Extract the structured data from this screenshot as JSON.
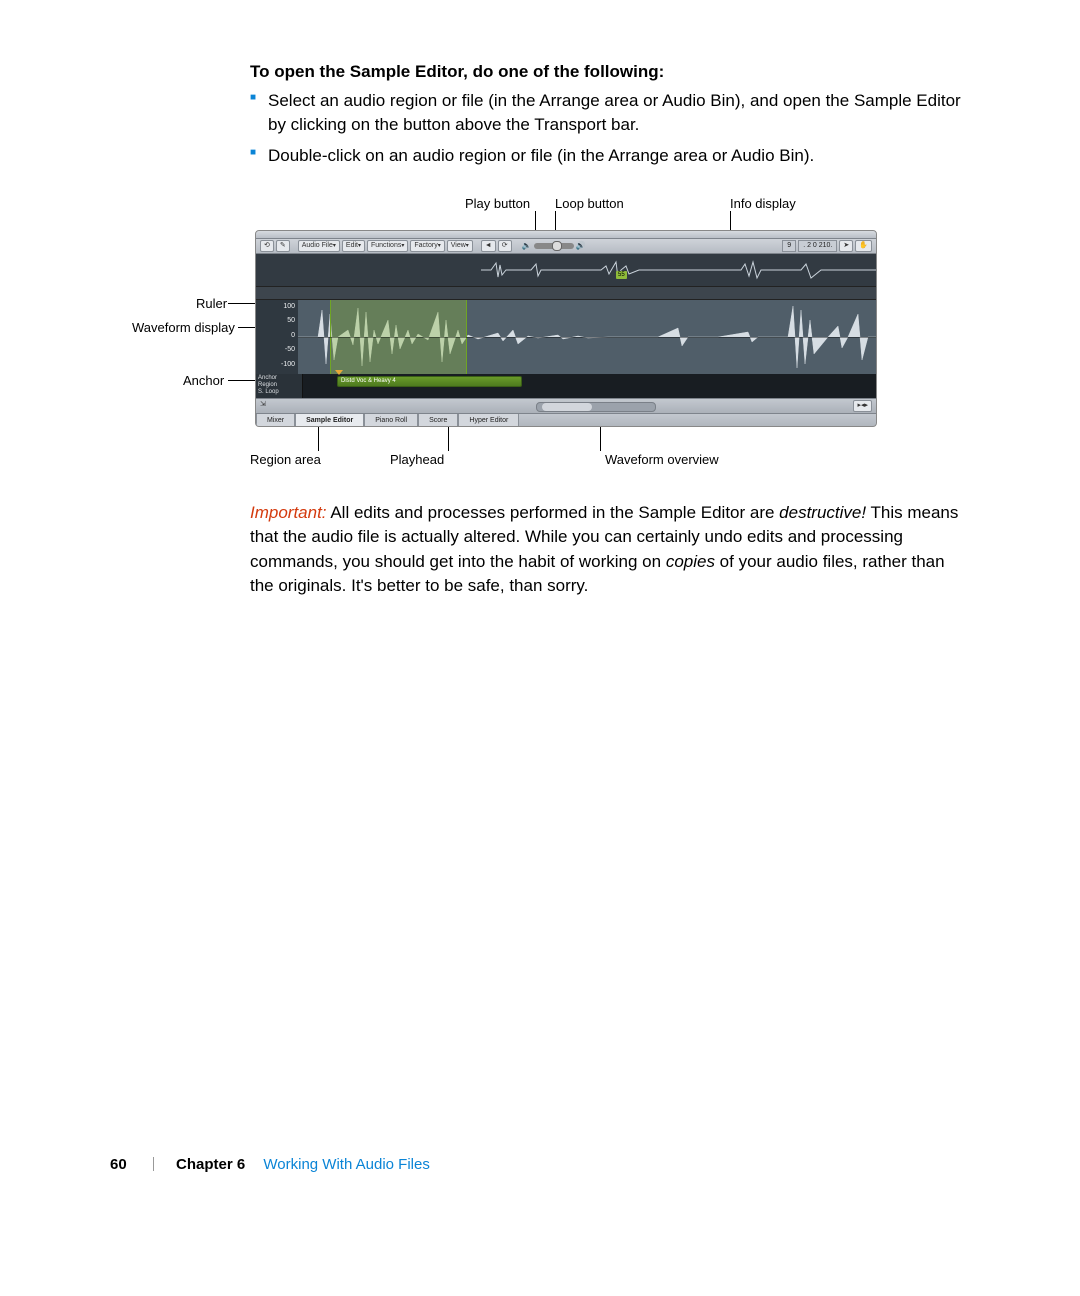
{
  "heading": "To open the Sample Editor, do one of the following:",
  "bullets": [
    "Select an audio region or file (in the Arrange area or Audio Bin), and open the Sample Editor by clicking on the button above the Transport bar.",
    "Double-click on an audio region or file (in the Arrange area or Audio Bin)."
  ],
  "callouts": {
    "play_button": "Play button",
    "loop_button": "Loop button",
    "info_display": "Info display",
    "ruler": "Ruler",
    "waveform_display": "Waveform display",
    "anchor": "Anchor",
    "region_area": "Region area",
    "playhead": "Playhead",
    "waveform_overview": "Waveform overview"
  },
  "screenshot": {
    "menus": [
      "Audio File",
      "Edit",
      "Functions",
      "Factory",
      "View"
    ],
    "info": {
      "a": "9",
      "b": ". 2  0 210."
    },
    "overview_marker": "55",
    "axis": [
      "100",
      "50",
      "0",
      "-50",
      "-100"
    ],
    "region_labels": [
      "Anchor",
      "Region",
      "S. Loop"
    ],
    "region_bar": "Distd Voc & Heavy 4",
    "tabs": [
      "Mixer",
      "Sample Editor",
      "Piano Roll",
      "Score",
      "Hyper Editor"
    ]
  },
  "important": {
    "label": "Important:",
    "text_before": "  All edits and processes performed in the Sample Editor are ",
    "em1": "destructive!",
    "text_mid": " This means that the audio file is actually altered. While you can certainly undo edits and processing commands, you should get into the habit of working on ",
    "em2": "copies",
    "text_after": " of your audio files, rather than the originals. It's better to be safe, than sorry."
  },
  "footer": {
    "page": "60",
    "chapter_label": "Chapter 6",
    "chapter_title": "Working With Audio Files"
  }
}
